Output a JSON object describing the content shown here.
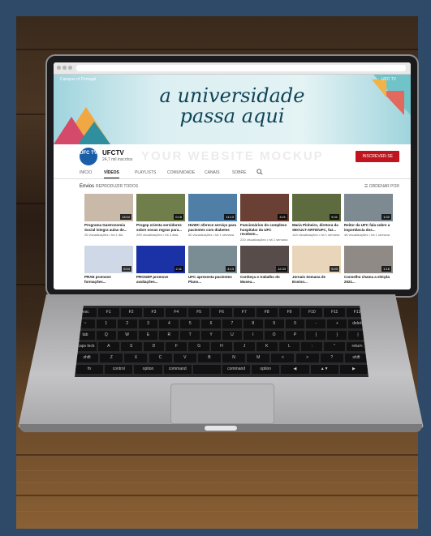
{
  "channel": {
    "banner_left": "Campus of Portugal",
    "banner_title_line1": "a universidade",
    "banner_title_line2": "passa aqui",
    "banner_right": "UFC TV",
    "avatar": "UFC TV",
    "name": "UFCTV",
    "subscribers": "24,7 mil inscritos",
    "watermark": "YOUR WEBSITE MOCKUP",
    "subscribe_label": "INSCREVER-SE"
  },
  "tabs": [
    "INÍCIO",
    "VÍDEOS",
    "PLAYLISTS",
    "COMUNIDADE",
    "CANAIS",
    "SOBRE"
  ],
  "section": {
    "title": "Envios",
    "play_all": "REPRODUZIR TODOS",
    "sort": "ORDENAR POR"
  },
  "videos": [
    {
      "title": "Programa Gastronomia Social integra aulas de...",
      "meta": "26 visualizações • há 1 dia",
      "duration": "13:04",
      "color": "#c9b9a9"
    },
    {
      "title": "Progep orienta servidores sobre novas regras para...",
      "meta": "289 visualizações • há 3 dias",
      "duration": "0:16",
      "color": "#6f7e4a"
    },
    {
      "title": "HUWC oferece serviço para pacientes com diabetes",
      "meta": "60 visualizações • há 1 semana",
      "duration": "11:13",
      "color": "#4f7fa6"
    },
    {
      "title": "Funcionários do complexo hospitalar da UFC recebem...",
      "meta": "220 visualizações • há 1 semana",
      "duration": "3:21",
      "color": "#6a3f34"
    },
    {
      "title": "Maria Pinheiro, diretora da SECULT-ARTE/UFC, faz...",
      "meta": "144 visualizações • há 1 semana",
      "duration": "5:31",
      "color": "#5d6b3e"
    },
    {
      "title": "Reitor da UFC fala sobre a importância dos...",
      "meta": "46 visualizações • há 1 semana",
      "duration": "1:02",
      "color": "#7d8a92"
    },
    {
      "title": "PRAE promove formações...",
      "meta": "",
      "duration": "6:04",
      "color": "#cfd8e6"
    },
    {
      "title": "PROGEP promove avaliações...",
      "meta": "",
      "duration": "2:11",
      "color": "#1a32a6"
    },
    {
      "title": "UFC apresenta pacientes Plano...",
      "meta": "",
      "duration": "4:13",
      "color": "#7a8d95"
    },
    {
      "title": "Conheça o trabalho do Museu...",
      "meta": "",
      "duration": "12:33",
      "color": "#584c4a"
    },
    {
      "title": "Jornais Semana de Ensino...",
      "meta": "",
      "duration": "5:03",
      "color": "#e9d5b9"
    },
    {
      "title": "Conselho chama a eleição 2021...",
      "meta": "",
      "duration": "1:16",
      "color": "#8f8a86"
    }
  ],
  "keyboard_rows": [
    [
      "esc",
      "F1",
      "F2",
      "F3",
      "F4",
      "F5",
      "F6",
      "F7",
      "F8",
      "F9",
      "F10",
      "F11",
      "F12"
    ],
    [
      "~",
      "1",
      "2",
      "3",
      "4",
      "5",
      "6",
      "7",
      "8",
      "9",
      "0",
      "-",
      "+",
      "delete"
    ],
    [
      "tab",
      "Q",
      "W",
      "E",
      "R",
      "T",
      "Y",
      "U",
      "I",
      "O",
      "P",
      "{",
      "}",
      "|"
    ],
    [
      "caps lock",
      "A",
      "S",
      "D",
      "F",
      "G",
      "H",
      "J",
      "K",
      "L",
      ":",
      "\"",
      "return"
    ],
    [
      "shift",
      "Z",
      "X",
      "C",
      "V",
      "B",
      "N",
      "M",
      "<",
      ">",
      "?",
      "shift"
    ],
    [
      "fn",
      "control",
      "option",
      "command",
      "",
      "command",
      "option",
      "◀",
      "▲▼",
      "▶"
    ]
  ]
}
